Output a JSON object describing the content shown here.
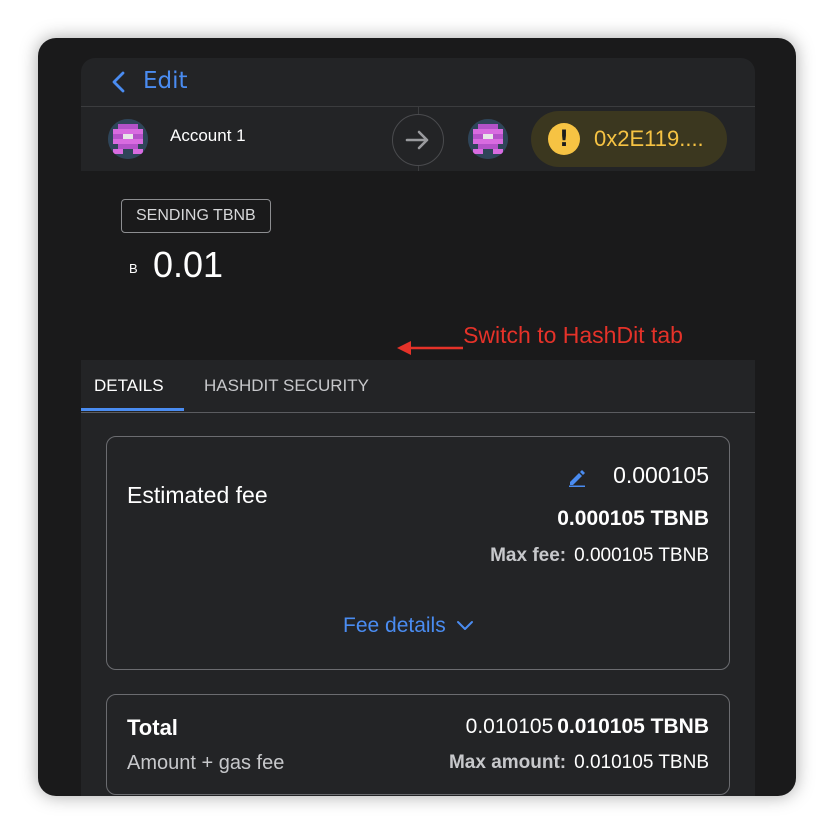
{
  "header": {
    "back_label": "Edit"
  },
  "from": {
    "account_name": "Account 1"
  },
  "to": {
    "address": "0x2E119...."
  },
  "send": {
    "badge": "SENDING TBNB",
    "currency_symbol": "B",
    "amount": "0.01"
  },
  "tabs": [
    {
      "label": "DETAILS",
      "active": true
    },
    {
      "label": "HASHDIT SECURITY",
      "active": false
    }
  ],
  "annotation": {
    "text": "Switch to HashDit tab"
  },
  "fee": {
    "label": "Estimated fee",
    "value_small": "0.000105",
    "value_bold": "0.000105 TBNB",
    "max_fee_label": "Max fee:",
    "max_fee_value": "0.000105 TBNB",
    "details_link": "Fee details"
  },
  "total": {
    "label": "Total",
    "sublabel": "Amount + gas fee",
    "value": "0.010105",
    "value_bold": "0.010105 TBNB",
    "max_amount_label": "Max amount:",
    "max_amount_value": "0.010105 TBNB"
  },
  "colors": {
    "accent": "#4a8cf1",
    "warning": "#f6c343",
    "annotation": "#e53229"
  }
}
